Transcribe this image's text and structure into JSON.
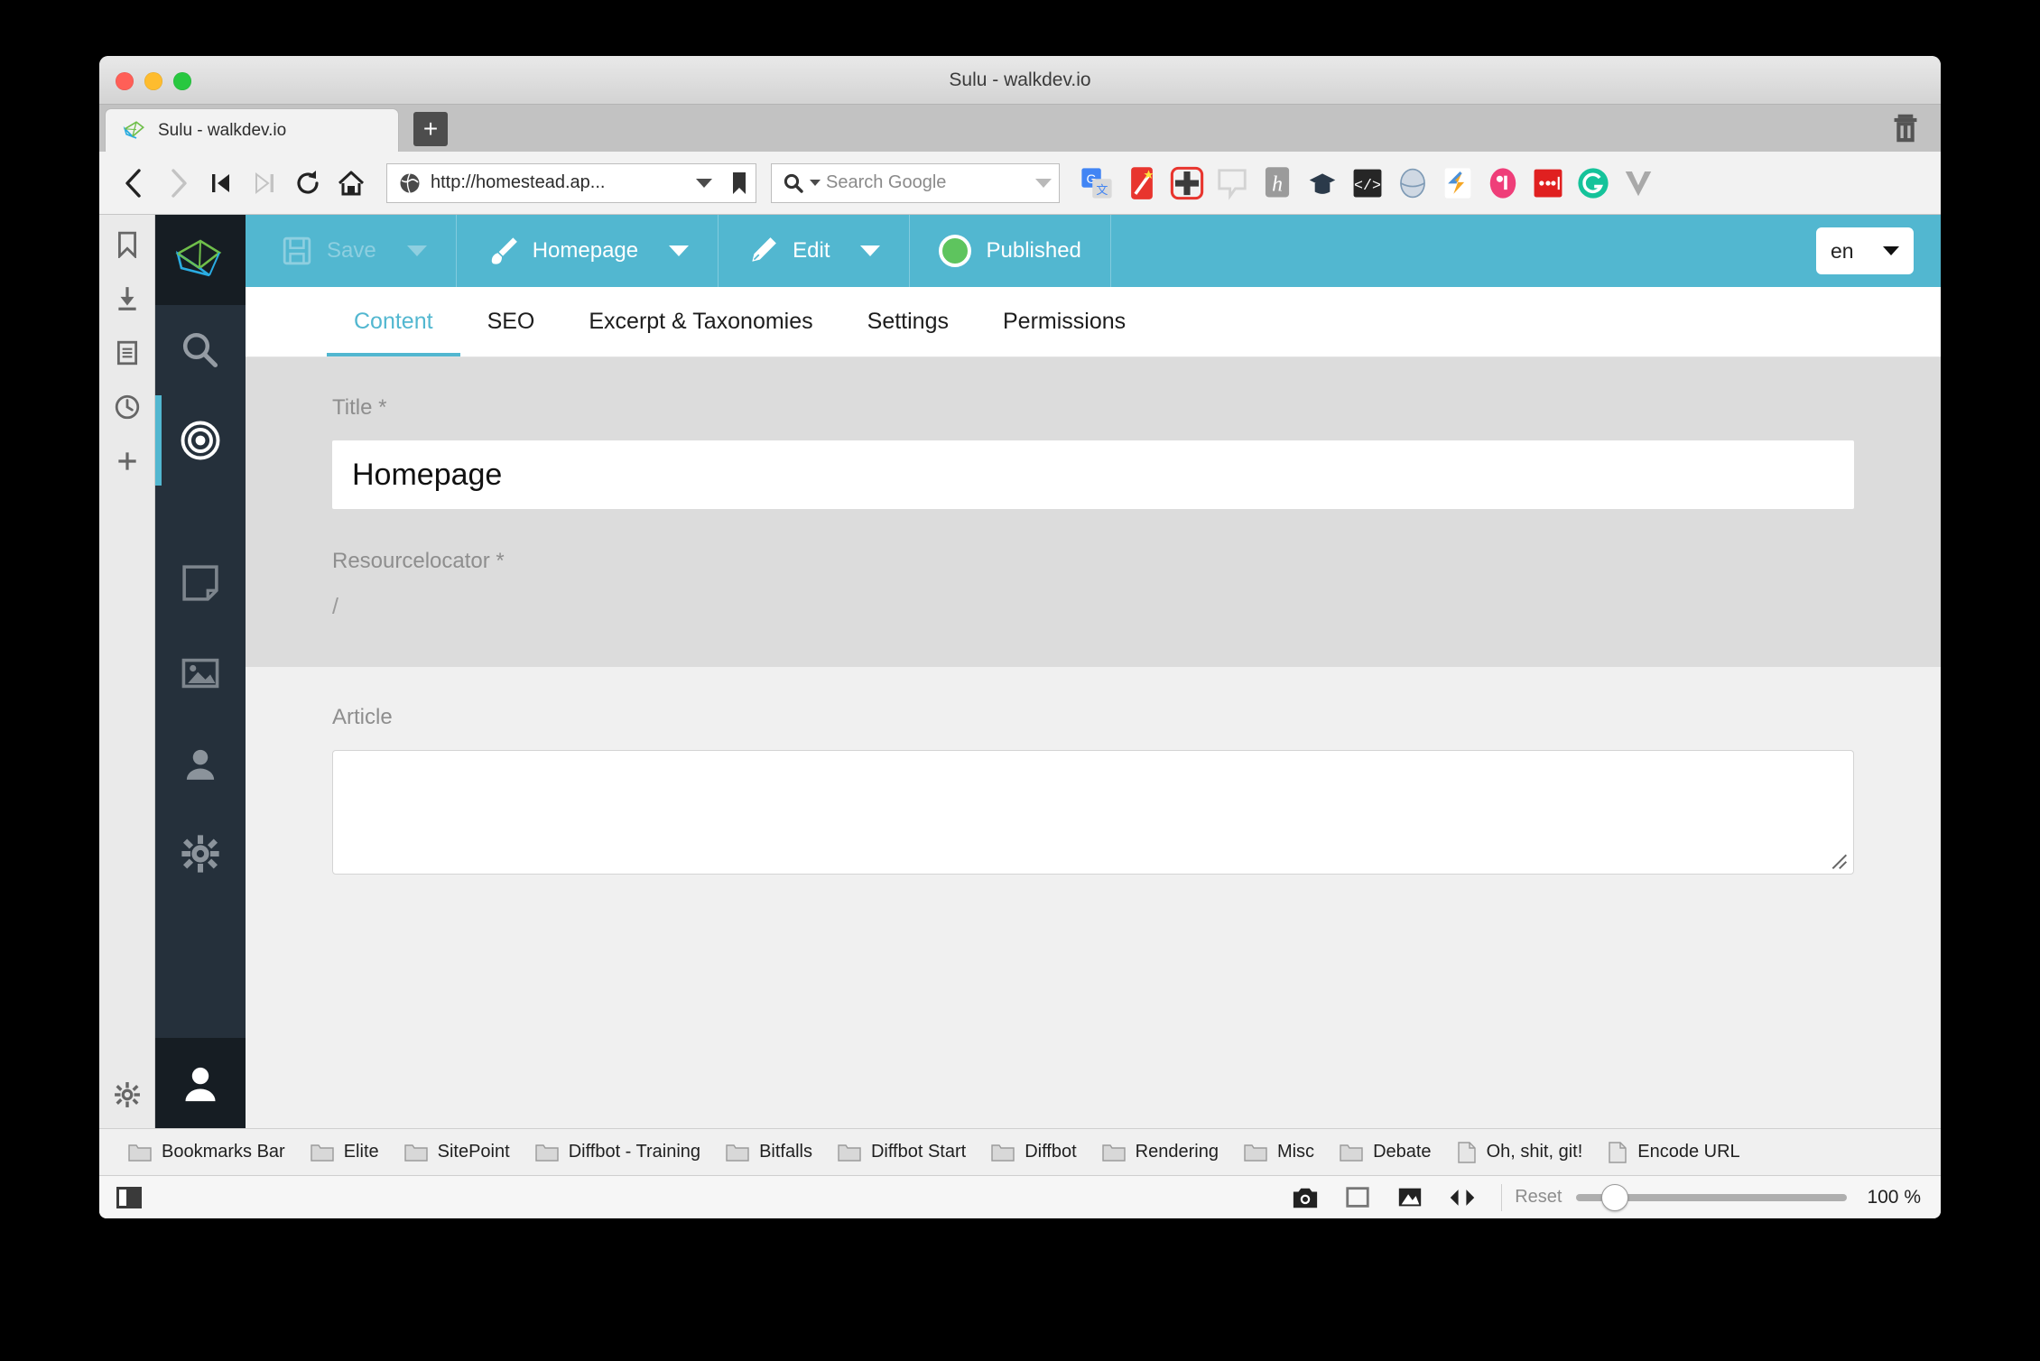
{
  "window": {
    "title": "Sulu - walkdev.io",
    "traffic_lights": [
      "close",
      "minimize",
      "maximize"
    ]
  },
  "tabstrip": {
    "tab_label": "Sulu - walkdev.io",
    "new_tab_label": "+",
    "trash_icon": "trash-icon"
  },
  "navbar": {
    "back_icon": "back-arrow-icon",
    "forward_icon": "forward-arrow-icon",
    "first_icon": "skip-back-icon",
    "last_icon": "skip-forward-icon",
    "reload_icon": "reload-icon",
    "home_icon": "home-icon",
    "url_value": "http://homestead.ap...",
    "bookmark_icon": "bookmark-icon",
    "search_placeholder": "Search Google",
    "extensions": [
      "google-translate-icon",
      "magic-wand-icon",
      "clock-plus-icon",
      "speech-bubble-icon",
      "hypothesis-icon",
      "mortarboard-icon",
      "code-brackets-icon",
      "globe-icon",
      "lightning-s-icon",
      "pocket-tag-icon",
      "ellipsis-red-icon",
      "grammarly-icon",
      "v-chevron-icon"
    ]
  },
  "leftrail": {
    "items": [
      {
        "icon": "bookmark-icon",
        "label": "Bookmarks"
      },
      {
        "icon": "download-icon",
        "label": "Downloads"
      },
      {
        "icon": "reading-list-icon",
        "label": "Reading List"
      },
      {
        "icon": "history-clock-icon",
        "label": "History"
      },
      {
        "icon": "plus-icon",
        "label": "Add"
      }
    ],
    "bottom": {
      "icon": "gear-icon",
      "label": "Settings"
    }
  },
  "sulu_nav": {
    "logo": "sulu-logo-icon",
    "items": [
      {
        "icon": "search-icon",
        "label": "Search",
        "active": false
      },
      {
        "icon": "target-icon",
        "label": "Webspaces",
        "active": true
      },
      {
        "icon": "snippet-icon",
        "label": "Snippets",
        "active": false
      },
      {
        "icon": "media-image-icon",
        "label": "Media",
        "active": false
      },
      {
        "icon": "contacts-user-icon",
        "label": "Contacts",
        "active": false
      },
      {
        "icon": "settings-gear-icon",
        "label": "Settings",
        "active": false
      }
    ],
    "bottom": {
      "icon": "user-avatar-icon",
      "label": "User"
    }
  },
  "sulu_toolbar": {
    "save": {
      "label": "Save",
      "icon": "floppy-disk-icon",
      "disabled": true,
      "has_dropdown": true
    },
    "template": {
      "label": "Homepage",
      "icon": "paintbrush-icon",
      "has_dropdown": true
    },
    "edit": {
      "label": "Edit",
      "icon": "pencil-icon",
      "has_dropdown": true
    },
    "state": {
      "label": "Published",
      "icon": "status-circle-icon",
      "color": "#5ec45e"
    },
    "language": {
      "value": "en"
    },
    "accent_color": "#52b7d0"
  },
  "sulu_tabs": [
    {
      "label": "Content",
      "active": true
    },
    {
      "label": "SEO",
      "active": false
    },
    {
      "label": "Excerpt & Taxonomies",
      "active": false
    },
    {
      "label": "Settings",
      "active": false
    },
    {
      "label": "Permissions",
      "active": false
    }
  ],
  "form": {
    "title_field": {
      "label": "Title *",
      "value": "Homepage"
    },
    "resourcelocator_field": {
      "label": "Resourcelocator *",
      "value": "/"
    },
    "article_field": {
      "label": "Article",
      "value": ""
    }
  },
  "bookmarks": [
    {
      "label": "Bookmarks Bar",
      "icon": "folder-icon"
    },
    {
      "label": "Elite",
      "icon": "folder-icon"
    },
    {
      "label": "SitePoint",
      "icon": "folder-icon"
    },
    {
      "label": "Diffbot - Training",
      "icon": "folder-icon"
    },
    {
      "label": "Bitfalls",
      "icon": "folder-icon"
    },
    {
      "label": "Diffbot Start",
      "icon": "folder-icon"
    },
    {
      "label": "Diffbot",
      "icon": "folder-icon"
    },
    {
      "label": "Rendering",
      "icon": "folder-icon"
    },
    {
      "label": "Misc",
      "icon": "folder-icon"
    },
    {
      "label": "Debate",
      "icon": "folder-icon"
    },
    {
      "label": "Oh, shit, git!",
      "icon": "page-icon"
    },
    {
      "label": "Encode URL",
      "icon": "page-icon"
    }
  ],
  "statusbar": {
    "sidebar_toggle_icon": "sidebar-toggle-icon",
    "camera_icon": "camera-icon",
    "square_icon": "square-icon",
    "image_icon": "image-icon",
    "code_icon": "code-arrows-icon",
    "reset_label": "Reset",
    "zoom_level": "100 %"
  }
}
